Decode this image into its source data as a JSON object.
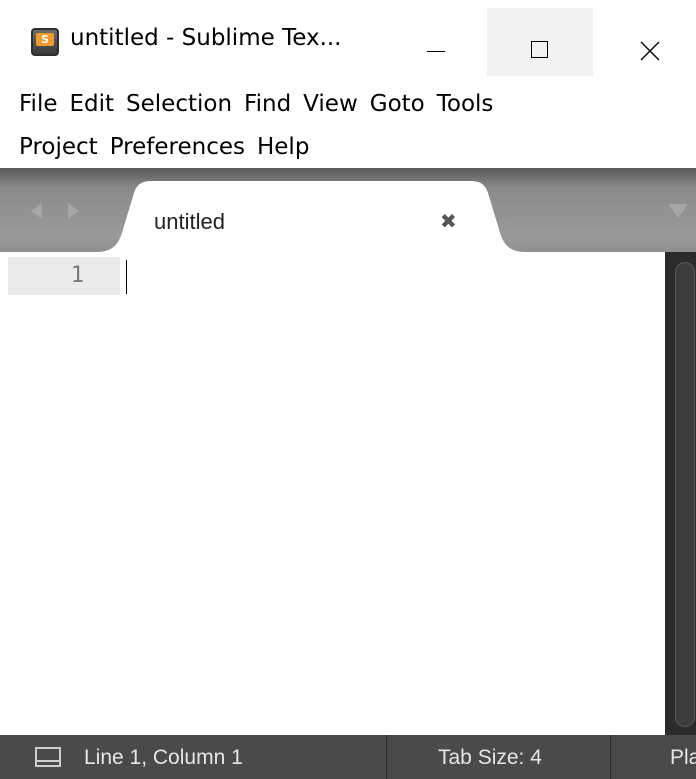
{
  "window": {
    "title": "untitled - Sublime Tex...",
    "app_icon_letter": "S",
    "controls": {
      "minimize": "minimize-icon",
      "maximize": "maximize-icon",
      "close": "close-icon"
    }
  },
  "menu": {
    "items": [
      "File",
      "Edit",
      "Selection",
      "Find",
      "View",
      "Goto",
      "Tools",
      "Project",
      "Preferences",
      "Help"
    ]
  },
  "tabs": {
    "active": {
      "label": "untitled",
      "close_glyph": "✖"
    },
    "nav_icons": [
      "tab-left-arrow-icon",
      "tab-right-arrow-icon"
    ],
    "dropdown_icon": "tab-list-dropdown-icon"
  },
  "editor": {
    "line_numbers": [
      "1"
    ],
    "content": ""
  },
  "status": {
    "position": "Line 1, Column 1",
    "tab_size": "Tab Size: 4",
    "syntax": "Plain Text"
  },
  "colors": {
    "tabbar": "#9a9a9a",
    "scrollbar": "#2b2b2b",
    "statusbar": "#4a4a4a",
    "line_highlight": "#ebebeb",
    "icon_orange": "#f29a2b"
  }
}
